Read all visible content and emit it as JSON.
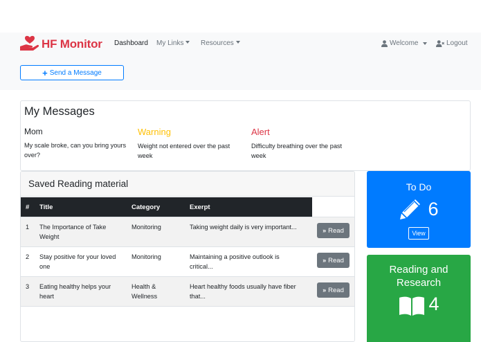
{
  "navbar": {
    "brand": "HF Monitor",
    "links": [
      {
        "label": "Dashboard",
        "active": true,
        "dropdown": false
      },
      {
        "label": "My Links",
        "active": false,
        "dropdown": true
      },
      {
        "label": "Resources",
        "active": false,
        "dropdown": true
      }
    ],
    "welcome": "Welcome",
    "logout": "Logout"
  },
  "send_button": "Send a Message",
  "messages": {
    "title": "My Messages",
    "items": [
      {
        "heading": "Mom",
        "type": "normal",
        "body": "My scale broke, can you bring yours over?"
      },
      {
        "heading": "Warning",
        "type": "warning",
        "body": "Weight not entered over the past week"
      },
      {
        "heading": "Alert",
        "type": "alert",
        "body": "Difficulty breathing over the past week"
      }
    ]
  },
  "reading": {
    "title": "Saved Reading material",
    "columns": [
      "#",
      "Title",
      "Category",
      "Exerpt"
    ],
    "rows": [
      {
        "num": "1",
        "title": "The Importance of Take Weight",
        "category": "Monitoring",
        "excerpt": "Taking weight daily is very important...",
        "button": "Read"
      },
      {
        "num": "2",
        "title": "Stay positive for your loved one",
        "category": "Monitoring",
        "excerpt": "Maintaining a positive outlook is critical...",
        "button": "Read"
      },
      {
        "num": "3",
        "title": "Eating healthy helps your heart",
        "category": "Health & Wellness",
        "excerpt": "Heart healthy foods usually have fiber that...",
        "button": "Read"
      }
    ]
  },
  "todo": {
    "title": "To Do",
    "count": "6",
    "button": "View"
  },
  "research": {
    "title": "Reading and Research",
    "count": "4"
  },
  "colors": {
    "brand": "#dc3545",
    "primary": "#007bff",
    "success": "#28a745",
    "warning": "#ffc107",
    "secondary": "#6c757d",
    "dark": "#212529"
  },
  "icons": {
    "brand": "heart-hand-icon",
    "send": "plus-icon",
    "welcome": "user-icon",
    "logout": "user-times-icon",
    "read": "angle-double-right-icon",
    "todo": "pencil-icon",
    "research": "book-open-icon"
  }
}
